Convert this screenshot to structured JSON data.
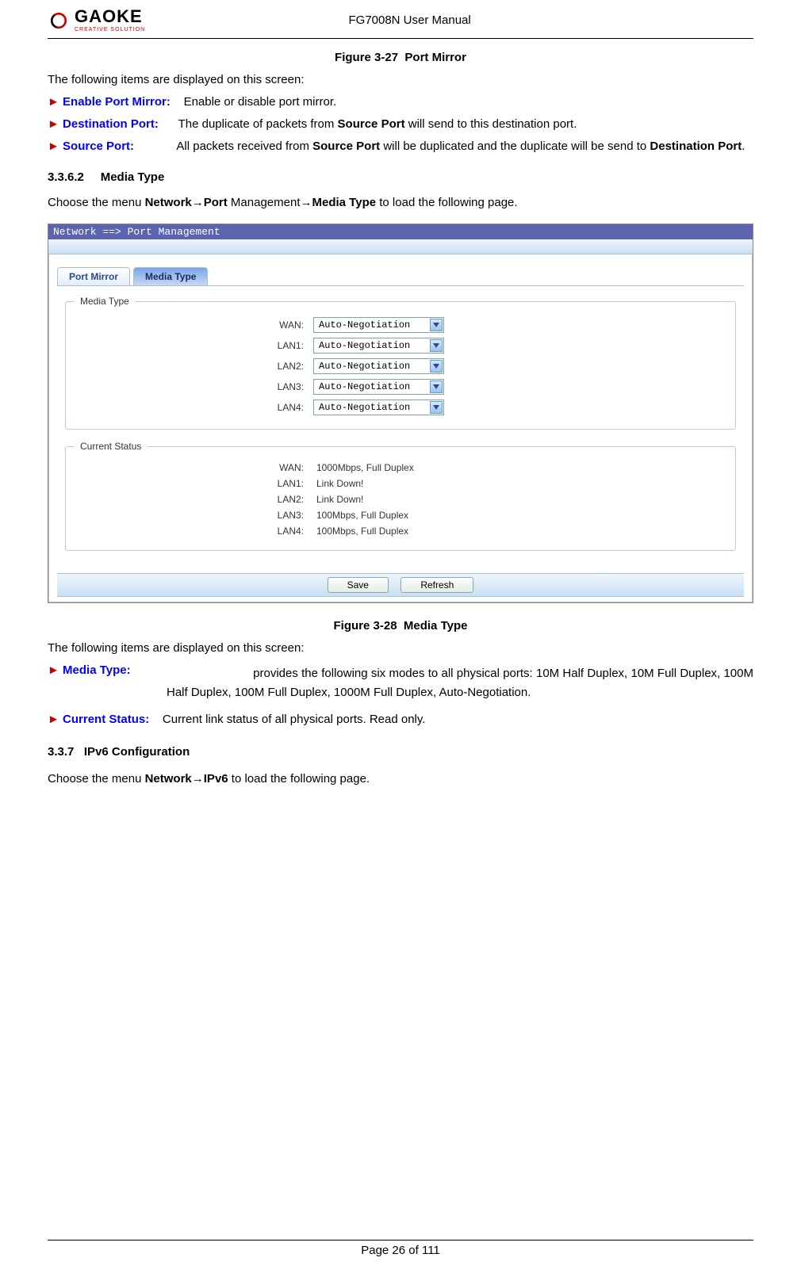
{
  "header": {
    "logo_name": "GAOKE",
    "logo_sub": "CREATIVE SOLUTION",
    "doc_title": "FG7008N User Manual"
  },
  "figure27": {
    "caption_prefix": "Figure 3-27",
    "caption_title": "Port Mirror",
    "intro": "The following items are displayed on this screen:",
    "items": {
      "enable_label": "Enable Port Mirror:",
      "enable_desc": "Enable or disable port mirror.",
      "dest_label": "Destination Port:",
      "dest_desc_pre": "The duplicate of packets from ",
      "dest_desc_bold": "Source Port",
      "dest_desc_post": " will send to this destination port.",
      "src_label": "Source Port:",
      "src_desc_pre": "All packets received from ",
      "src_desc_bold1": "Source Port",
      "src_desc_mid": " will be duplicated and the duplicate will be send to ",
      "src_desc_bold2": "Destination Port",
      "src_desc_post": "."
    }
  },
  "section_media": {
    "number": "3.3.6.2",
    "title": "Media Type",
    "menu_pre": "Choose the menu ",
    "menu_b1": "Network",
    "menu_arrow": "→",
    "menu_b2": "Port",
    "menu_nl": " Management",
    "menu_b3": "Media Type",
    "menu_post": " to load the following page."
  },
  "screenshot": {
    "breadcrumb": "Network ==> Port Management",
    "tabs": {
      "port_mirror": "Port Mirror",
      "media_type": "Media Type"
    },
    "group1_legend": "Media Type",
    "group1_rows": [
      {
        "label": "WAN:",
        "value": "Auto-Negotiation"
      },
      {
        "label": "LAN1:",
        "value": "Auto-Negotiation"
      },
      {
        "label": "LAN2:",
        "value": "Auto-Negotiation"
      },
      {
        "label": "LAN3:",
        "value": "Auto-Negotiation"
      },
      {
        "label": "LAN4:",
        "value": "Auto-Negotiation"
      }
    ],
    "group2_legend": "Current Status",
    "group2_rows": [
      {
        "label": "WAN:",
        "value": "1000Mbps, Full Duplex"
      },
      {
        "label": "LAN1:",
        "value": "Link Down!"
      },
      {
        "label": "LAN2:",
        "value": "Link Down!"
      },
      {
        "label": "LAN3:",
        "value": "100Mbps, Full Duplex"
      },
      {
        "label": "LAN4:",
        "value": "100Mbps, Full Duplex"
      }
    ],
    "buttons": {
      "save": "Save",
      "refresh": "Refresh"
    }
  },
  "figure28": {
    "caption_prefix": "Figure 3-28",
    "caption_title": "Media Type",
    "intro": "The following items are displayed on this screen:",
    "items": {
      "media_label": "Media Type:",
      "media_desc": "provides the following six modes to all physical ports: 10M Half Duplex, 10M Full Duplex, 100M Half Duplex, 100M Full Duplex, 1000M Full Duplex, Auto-Negotiation.",
      "status_label": "Current Status:",
      "status_desc": "Current link status of all physical ports. Read only."
    }
  },
  "section_ipv6": {
    "number": "3.3.7",
    "title": "IPv6 Configuration",
    "menu_pre": "Choose the menu ",
    "menu_b1": "Network",
    "menu_arrow": "→",
    "menu_b2": "IPv6",
    "menu_post": " to load the following page."
  },
  "footer": {
    "page_text": "Page 26 of 111"
  }
}
